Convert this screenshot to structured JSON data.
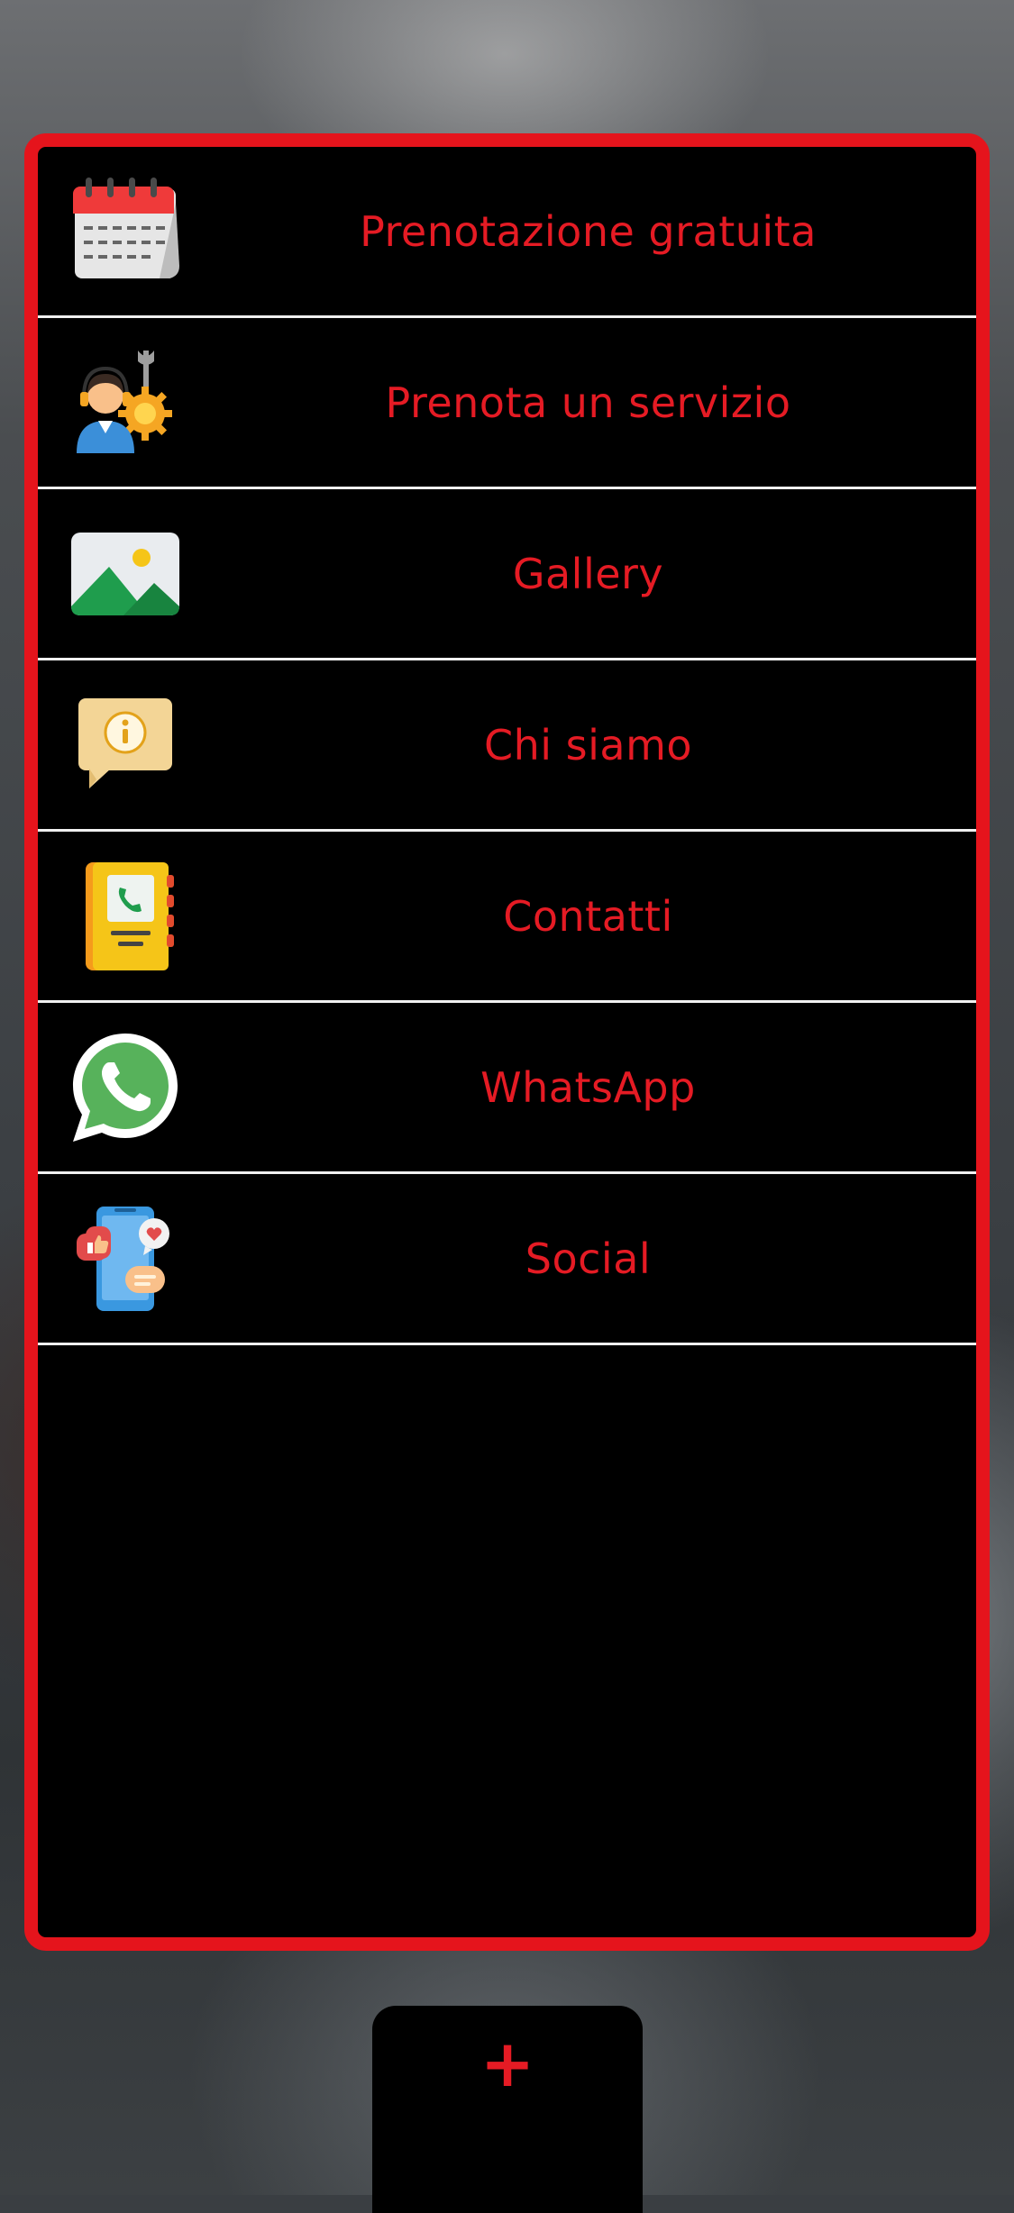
{
  "menu": {
    "items": [
      {
        "label": "Prenotazione gratuita",
        "icon": "calendar-icon"
      },
      {
        "label": "Prenota un servizio",
        "icon": "technician-icon"
      },
      {
        "label": "Gallery",
        "icon": "image-icon"
      },
      {
        "label": "Chi siamo",
        "icon": "info-bubble-icon"
      },
      {
        "label": "Contatti",
        "icon": "phonebook-icon"
      },
      {
        "label": "WhatsApp",
        "icon": "whatsapp-icon"
      },
      {
        "label": "Social",
        "icon": "social-icon"
      }
    ]
  },
  "fab": {
    "label": "+"
  },
  "colors": {
    "accent": "#e51b24",
    "panel_background": "#000000",
    "divider": "#f0f0f0"
  }
}
